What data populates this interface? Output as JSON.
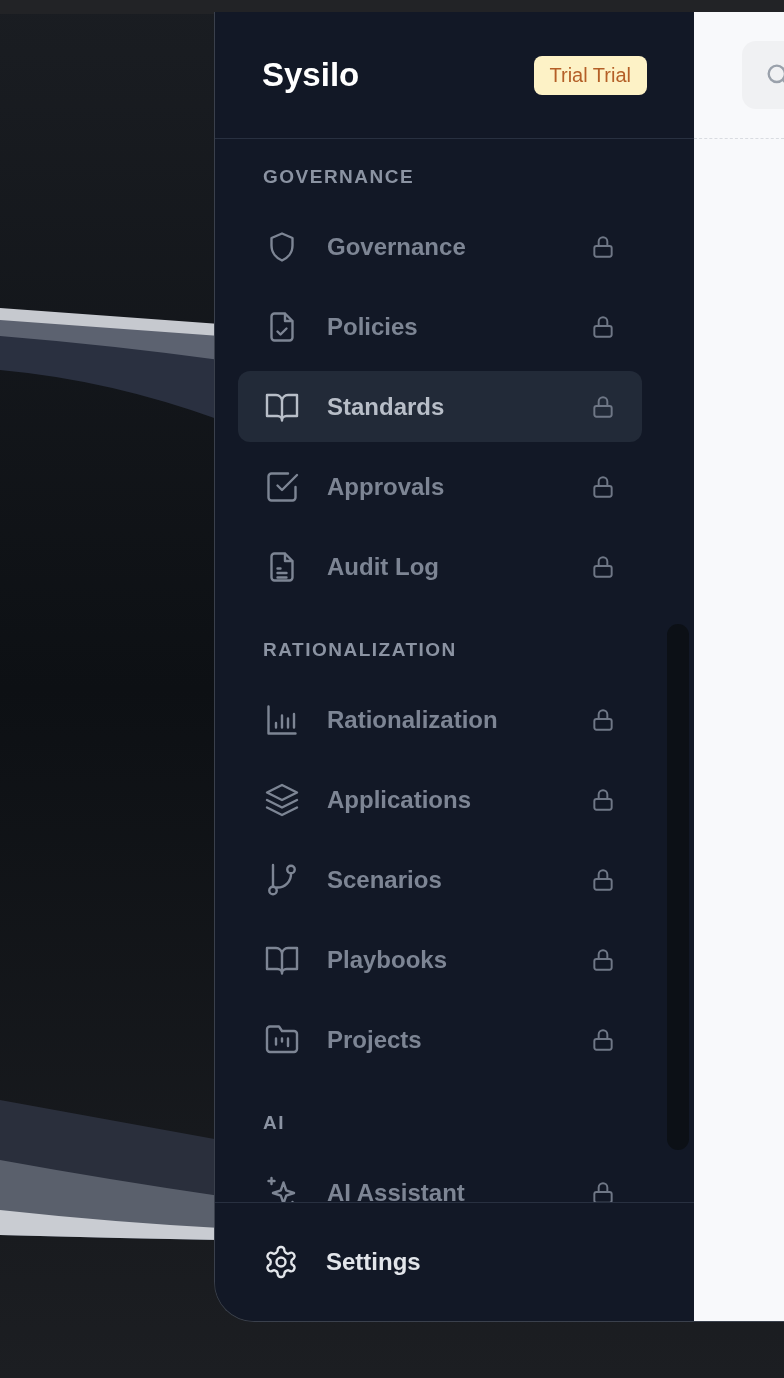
{
  "sidebar": {
    "logo": "Sysilo",
    "badge": "Trial Trial",
    "sections": [
      {
        "title": "GOVERNANCE",
        "items": [
          {
            "label": "Governance",
            "locked": true,
            "selected": false
          },
          {
            "label": "Policies",
            "locked": true,
            "selected": false
          },
          {
            "label": "Standards",
            "locked": true,
            "selected": true
          },
          {
            "label": "Approvals",
            "locked": true,
            "selected": false
          },
          {
            "label": "Audit Log",
            "locked": true,
            "selected": false
          }
        ]
      },
      {
        "title": "RATIONALIZATION",
        "items": [
          {
            "label": "Rationalization",
            "locked": true,
            "selected": false
          },
          {
            "label": "Applications",
            "locked": true,
            "selected": false
          },
          {
            "label": "Scenarios",
            "locked": true,
            "selected": false
          },
          {
            "label": "Playbooks",
            "locked": true,
            "selected": false
          },
          {
            "label": "Projects",
            "locked": true,
            "selected": false
          }
        ]
      },
      {
        "title": "AI",
        "items": [
          {
            "label": "AI Assistant",
            "locked": true,
            "selected": false
          }
        ]
      }
    ],
    "footer": {
      "label": "Settings"
    }
  },
  "header": {
    "search": {
      "kind": "search"
    }
  }
}
